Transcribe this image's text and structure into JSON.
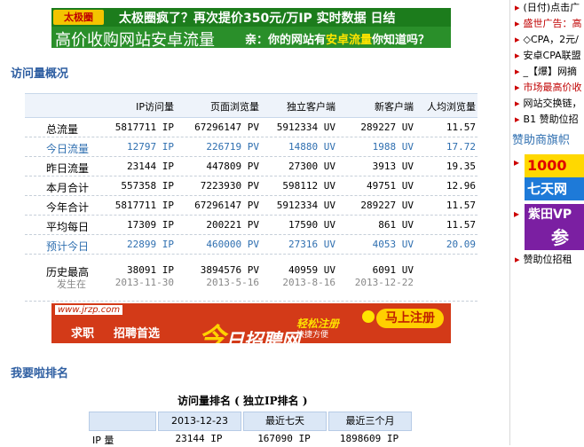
{
  "banner_top": {
    "logo_text": "太极圈",
    "line1": "太极圈疯了？再次提价350元/万IP 实时数据 日结",
    "line2": "高价收购网站安卓流量",
    "line3_prefix": "亲：你的网站有",
    "line3_highlight": "安卓流量",
    "line3_suffix": "你知道吗？"
  },
  "overview": {
    "title": "访问量概况",
    "columns": [
      "IP访问量",
      "页面浏览量",
      "独立客户端",
      "新客户端",
      "人均浏览量"
    ],
    "rows": [
      {
        "label": "总流量",
        "ip": "5817711 IP",
        "pv": "67296147 PV",
        "uv": "5912334 UV",
        "new": "289227 UV",
        "avg": "11.57",
        "style": "normal"
      },
      {
        "label": "今日流量",
        "ip": "12797 IP",
        "pv": "226719 PV",
        "uv": "14880 UV",
        "new": "1988 UV",
        "avg": "17.72",
        "style": "blue"
      },
      {
        "label": "昨日流量",
        "ip": "23144 IP",
        "pv": "447809 PV",
        "uv": "27300 UV",
        "new": "3913 UV",
        "avg": "19.35",
        "style": "normal"
      },
      {
        "label": "本月合计",
        "ip": "557358 IP",
        "pv": "7223930 PV",
        "uv": "598112 UV",
        "new": "49751 UV",
        "avg": "12.96",
        "style": "normal"
      },
      {
        "label": "今年合计",
        "ip": "5817711 IP",
        "pv": "67296147 PV",
        "uv": "5912334 UV",
        "new": "289227 UV",
        "avg": "11.57",
        "style": "normal"
      },
      {
        "label": "平均每日",
        "ip": "17309 IP",
        "pv": "200221 PV",
        "uv": "17590 UV",
        "new": "861 UV",
        "avg": "11.57",
        "style": "normal"
      },
      {
        "label": "预计今日",
        "ip": "22899 IP",
        "pv": "460000 PV",
        "uv": "27316 UV",
        "new": "4053 UV",
        "avg": "20.09",
        "style": "blue"
      }
    ],
    "history": {
      "label": "历史最高",
      "sublabel": "发生在",
      "ip": "38091 IP",
      "pv": "3894576 PV",
      "uv": "40959 UV",
      "new": "6091 UV",
      "ip_date": "2013-11-30",
      "pv_date": "2013-5-16",
      "uv_date": "2013-8-16",
      "new_date": "2013-12-22"
    }
  },
  "banner_jobs": {
    "url": "www.jrzp.com",
    "left1": "求职",
    "left2": "招聘首选",
    "brand_big": "今",
    "brand_rest": "日招聘网",
    "slogan1": "轻松注册",
    "slogan2": "快捷方便",
    "register": "马上注册"
  },
  "ranking": {
    "section_title": "我要啦排名",
    "table_title": "访问量排名 ( 独立IP排名 )",
    "columns": [
      "2013-12-23",
      "最近七天",
      "最近三个月"
    ],
    "row_label": "IP 量",
    "values": [
      "23144 IP",
      "167090 IP",
      "1898609 IP"
    ]
  },
  "sidebar": {
    "items": [
      {
        "text": "(日付)点击广",
        "color": "normal"
      },
      {
        "text": "盛世广告：高",
        "color": "red"
      },
      {
        "text": "◇CPA，2元/",
        "color": "normal"
      },
      {
        "text": "安卓CPA联盟",
        "color": "normal"
      },
      {
        "text": "_【爆】网摘",
        "color": "normal"
      },
      {
        "text": "市场最高价收",
        "color": "red"
      },
      {
        "text": "网站交换链，",
        "color": "normal"
      },
      {
        "text": "B1 赞助位招",
        "color": "normal"
      }
    ],
    "sponsor_title": "赞助商旗帜",
    "sponsor1_line1": "1000",
    "sponsor1_line2": "七天网",
    "sponsor2_line1": "紫田VP",
    "sponsor2_line2": "参",
    "sponsor_footer": "赞助位招租"
  }
}
